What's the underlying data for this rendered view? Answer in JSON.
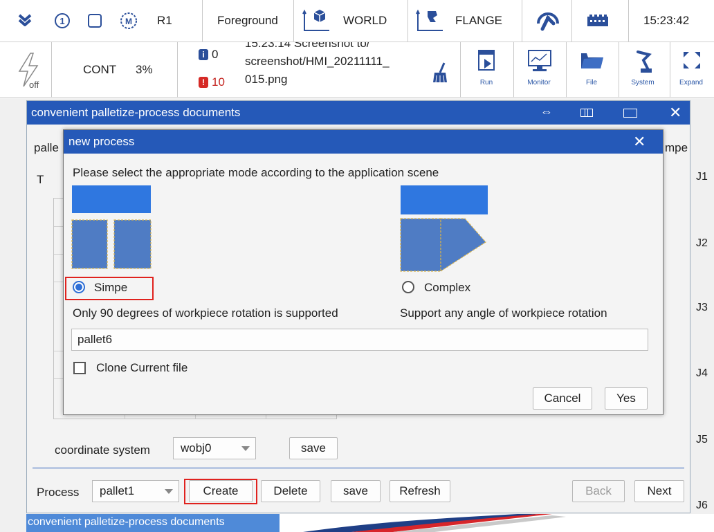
{
  "topbar": {
    "robot": "R1",
    "mode": "Foreground",
    "coord_world": "WORLD",
    "coord_tool": "FLANGE",
    "clock": "15:23:42"
  },
  "toolbar": {
    "power_state": "off",
    "run_mode": "CONT",
    "speed": "3%",
    "info_count": "0",
    "error_count": "10",
    "message_line1": "15:23:14 Screenshot to/",
    "message_line2": "screenshot/HMI_20211111_",
    "message_line3": "015.png",
    "tools": [
      {
        "label": "Run"
      },
      {
        "label": "Monitor"
      },
      {
        "label": "File"
      },
      {
        "label": "System"
      },
      {
        "label": "Expand"
      }
    ]
  },
  "window": {
    "title": "convenient palletize-process documents",
    "partial_left": "palle",
    "partial_right": "mpe",
    "partial_t": "T",
    "coordinate_label": "coordinate system",
    "coordinate_value": "wobj0",
    "coord_save": "save",
    "process_label": "Process",
    "process_value": "pallet1",
    "buttons": {
      "create": "Create",
      "delete": "Delete",
      "save": "save",
      "refresh": "Refresh",
      "back": "Back",
      "next": "Next"
    }
  },
  "dialog": {
    "title": "new process",
    "instruction": "Please select the appropriate mode according to the application scene",
    "simple_label": "Simpe",
    "complex_label": "Complex",
    "simple_desc": "Only 90 degrees of workpiece rotation is supported",
    "complex_desc": "Support any angle of workpiece rotation",
    "name_value": "pallet6",
    "clone_label": "Clone Current file",
    "cancel": "Cancel",
    "yes": "Yes"
  },
  "joints": [
    "J1",
    "J2",
    "J3",
    "J4",
    "J5",
    "J6"
  ],
  "taskbar": {
    "label": "convenient palletize-process documents"
  },
  "colors": {
    "titlebar": "#2559b8",
    "highlight": "#e0221e",
    "tile": "#2f77e0",
    "tile_dashed": "#4f7cc4"
  }
}
